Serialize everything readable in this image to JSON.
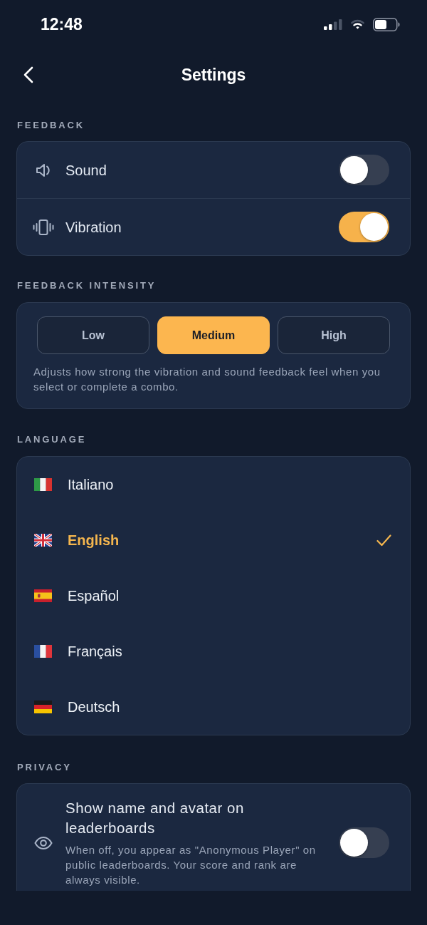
{
  "status_bar": {
    "time": "12:48"
  },
  "header": {
    "title": "Settings"
  },
  "feedback": {
    "heading": "FEEDBACK",
    "rows": [
      {
        "label": "Sound",
        "on": false
      },
      {
        "label": "Vibration",
        "on": true
      }
    ]
  },
  "feedback_intensity": {
    "heading": "FEEDBACK INTENSITY",
    "options": [
      {
        "label": "Low",
        "selected": false
      },
      {
        "label": "Medium",
        "selected": true
      },
      {
        "label": "High",
        "selected": false
      }
    ],
    "description": "Adjusts how strong the vibration and sound feedback feel when you select or complete a combo."
  },
  "language": {
    "heading": "LANGUAGE",
    "items": [
      {
        "label": "Italiano",
        "selected": false
      },
      {
        "label": "English",
        "selected": true
      },
      {
        "label": "Español",
        "selected": false
      },
      {
        "label": "Français",
        "selected": false
      },
      {
        "label": "Deutsch",
        "selected": false
      }
    ]
  },
  "privacy": {
    "heading": "PRIVACY",
    "rows": [
      {
        "title": "Show name and avatar on leaderboards",
        "description": "When off, you appear as \"Anonymous Player\" on public leaderboards. Your score and rank are always visible.",
        "on": false
      }
    ]
  }
}
